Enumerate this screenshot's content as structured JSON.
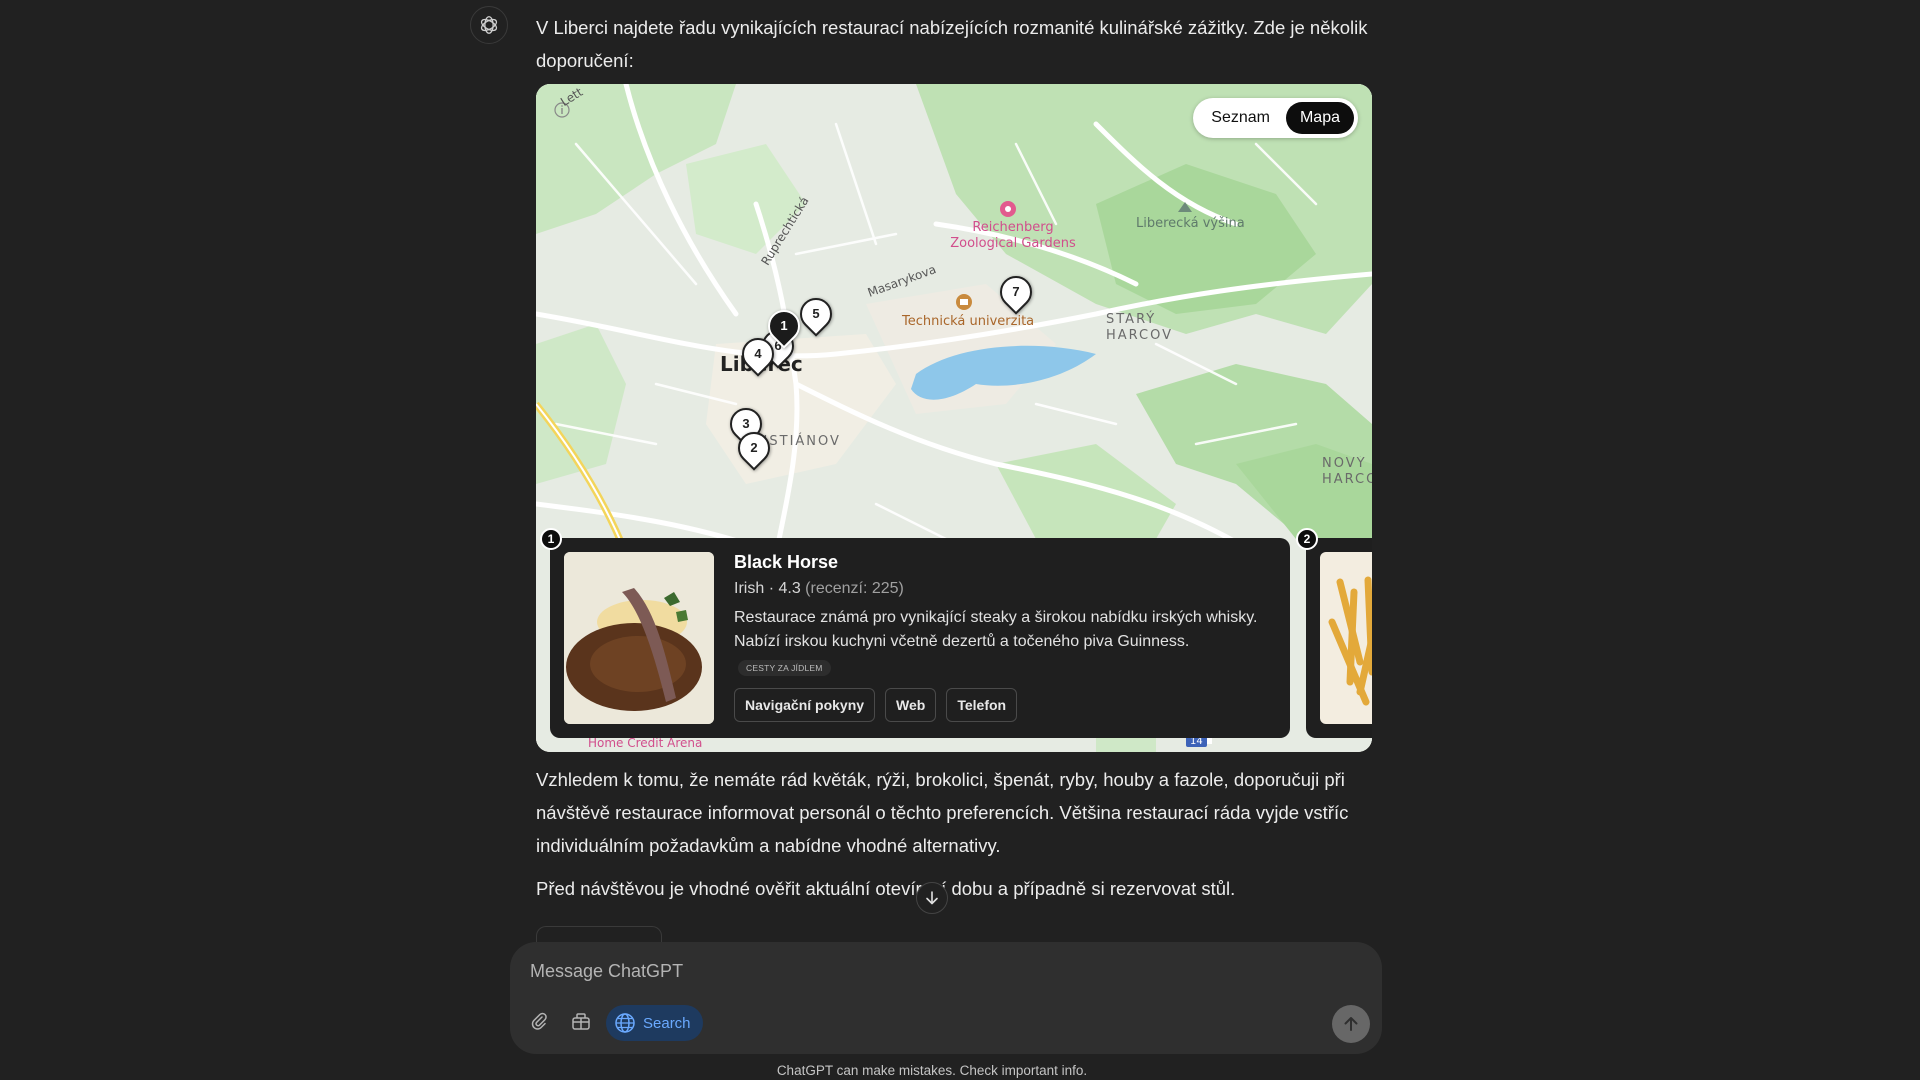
{
  "assistant": {
    "intro": "V Liberci najdete řadu vynikajících restaurací nabízejících rozmanité kulinářské zážitky. Zde je několik doporučení:",
    "after_map": "Vzhledem k tomu, že nemáte rád květák, rýži, brokolici, špenát, ryby, houby a fazole, doporučuji při návštěvě restaurace informovat personál o těchto preferencích. Většina restaurací ráda vyjde vstříc individuálním požadavkům a nabídne vhodné alternativy.",
    "last_line": "Před návštěvou je vhodné ověřit aktuální otevírací dobu a případně si rezervovat stůl."
  },
  "map": {
    "toggle": {
      "list_label": "Seznam",
      "map_label": "Mapa",
      "active": "Mapa"
    },
    "labels": {
      "city": "Liberec",
      "zoo": "Reichenberg Zoological Gardens",
      "university": "Technická univerzita",
      "district1": "STARÝ HARCOV",
      "district2": "KRISTIÁNOV",
      "district3": "NOVÝ HARCOV",
      "hill": "Liberecká výšina",
      "street1": "Ruprechtická",
      "street2": "Masarykova",
      "arena": "Home Credit Arena",
      "road_shield": "14",
      "street_top": "Lett"
    },
    "pins": [
      "1",
      "2",
      "3",
      "4",
      "5",
      "6",
      "7"
    ]
  },
  "restaurant_cards": [
    {
      "index": "1",
      "name": "Black Horse",
      "cuisine": "Irish",
      "rating": "4.3",
      "reviews": "(recenzí: 225)",
      "description": "Restaurace známá pro vynikající steaky a širokou nabídku irských whisky. Nabízí irskou kuchyni včetně dezertů a točeného piva Guinness.",
      "source": "CESTY ZA JÍDLEM",
      "buttons": {
        "directions": "Navigační pokyny",
        "web": "Web",
        "phone": "Telefon"
      }
    },
    {
      "index": "2"
    }
  ],
  "composer": {
    "placeholder": "Message ChatGPT",
    "search_label": "Search"
  },
  "footer": "ChatGPT can make mistakes. Check important info.",
  "colors": {
    "background": "#212121",
    "composer": "#2f2f2f",
    "search_accent": "#6aa9ff",
    "card": "#1f1f1f"
  }
}
